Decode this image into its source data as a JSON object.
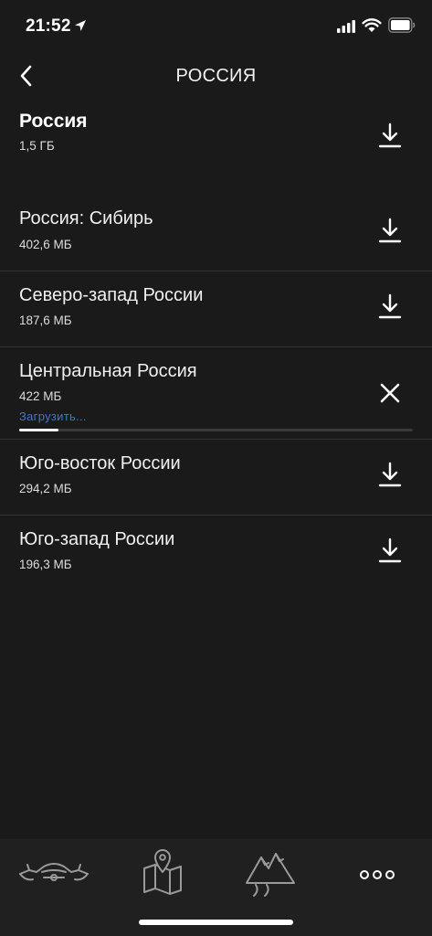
{
  "status_bar": {
    "time": "21:52"
  },
  "nav": {
    "title": "РОССИЯ"
  },
  "region": {
    "name": "Россия",
    "size": "1,5 ГБ"
  },
  "items": [
    {
      "title": "Россия: Сибирь",
      "size": "402,6 МБ",
      "action": "download"
    },
    {
      "title": "Северо-запад России",
      "size": "187,6 МБ",
      "action": "download"
    },
    {
      "title": "Центральная Россия",
      "size": "422 МБ",
      "action": "cancel",
      "status": "Загрузить...",
      "progress": 0.1
    },
    {
      "title": "Юго-восток России",
      "size": "294,2 МБ",
      "action": "download"
    },
    {
      "title": "Юго-запад России",
      "size": "196,3 МБ",
      "action": "download"
    }
  ],
  "tab_bar": {
    "tabs": [
      {
        "icon": "motorcycle-icon"
      },
      {
        "icon": "map-pin-icon"
      },
      {
        "icon": "mountains-icon"
      },
      {
        "icon": "more-dots-icon"
      }
    ]
  },
  "colors": {
    "background": "#1a1a1a",
    "accent": "#3e74d8",
    "tab_bar": "#202020",
    "divider": "#333333"
  }
}
